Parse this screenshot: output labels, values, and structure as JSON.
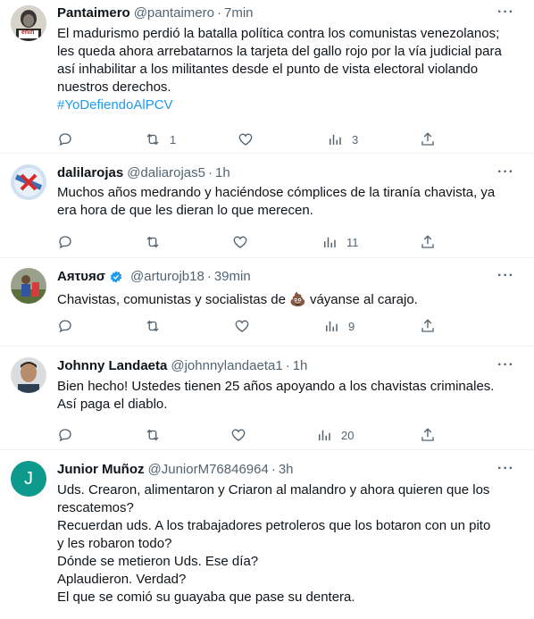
{
  "tweets": [
    {
      "name": "Pantaimero",
      "handle": "@pantaimero",
      "time": "7min",
      "lines": [
        "El madurismo perdió la batalla política contra los comunistas venezolanos;",
        "les queda ahora arrebatarnos la tarjeta del gallo rojo por la vía judicial para",
        "así inhabilitar a los militantes desde el punto de vista electoral violando",
        "nuestros derechos."
      ],
      "hashtag": "#YoDefiendoAlPCV",
      "avatar_label": "enin",
      "counts": {
        "replies": "",
        "retweets": "1",
        "likes": "",
        "views": "3"
      }
    },
    {
      "name": "dalilarojas",
      "handle": "@daliarojas5",
      "time": "1h",
      "lines": [
        "Muchos años medrando y haciéndose cómplices de la tiranía chavista, ya",
        "era hora de que les dieran lo que merecen."
      ],
      "counts": {
        "replies": "",
        "retweets": "",
        "likes": "",
        "views": "11"
      }
    },
    {
      "name": "Aяτυяσ",
      "handle": "@arturojb18",
      "time": "39min",
      "lines": [
        "Chavistas, comunistas y socialistas de 💩 váyanse al carajo."
      ],
      "counts": {
        "replies": "",
        "retweets": "",
        "likes": "",
        "views": "9"
      }
    },
    {
      "name": "Johnny Landaeta",
      "handle": "@johnnylandaeta1",
      "time": "1h",
      "lines": [
        "Bien hecho!  Ustedes tienen 25 años apoyando a los chavistas criminales.",
        "Así paga el diablo."
      ],
      "counts": {
        "replies": "",
        "retweets": "",
        "likes": "",
        "views": "20"
      }
    },
    {
      "name": "Junior Muñoz",
      "handle": "@JuniorM76846964",
      "time": "3h",
      "avatar_letter": "J",
      "lines": [
        "Uds. Crearon, alimentaron y Criaron al malandro y ahora quieren que los",
        "rescatemos?",
        "Recuerdan uds. A los trabajadores petroleros que los botaron con un pito",
        "y les robaron todo?",
        "Dónde se metieron Uds. Ese día?",
        "Aplaudieron. Verdad?",
        "El que se comió su guayaba que pase su dentera."
      ]
    }
  ],
  "ui": {
    "dot": "·",
    "more": "···"
  },
  "colors": {
    "link": "#1d9bf0",
    "muted": "#536471",
    "divider": "#eff3f4",
    "junior_avatar": "#0d9a8c"
  }
}
